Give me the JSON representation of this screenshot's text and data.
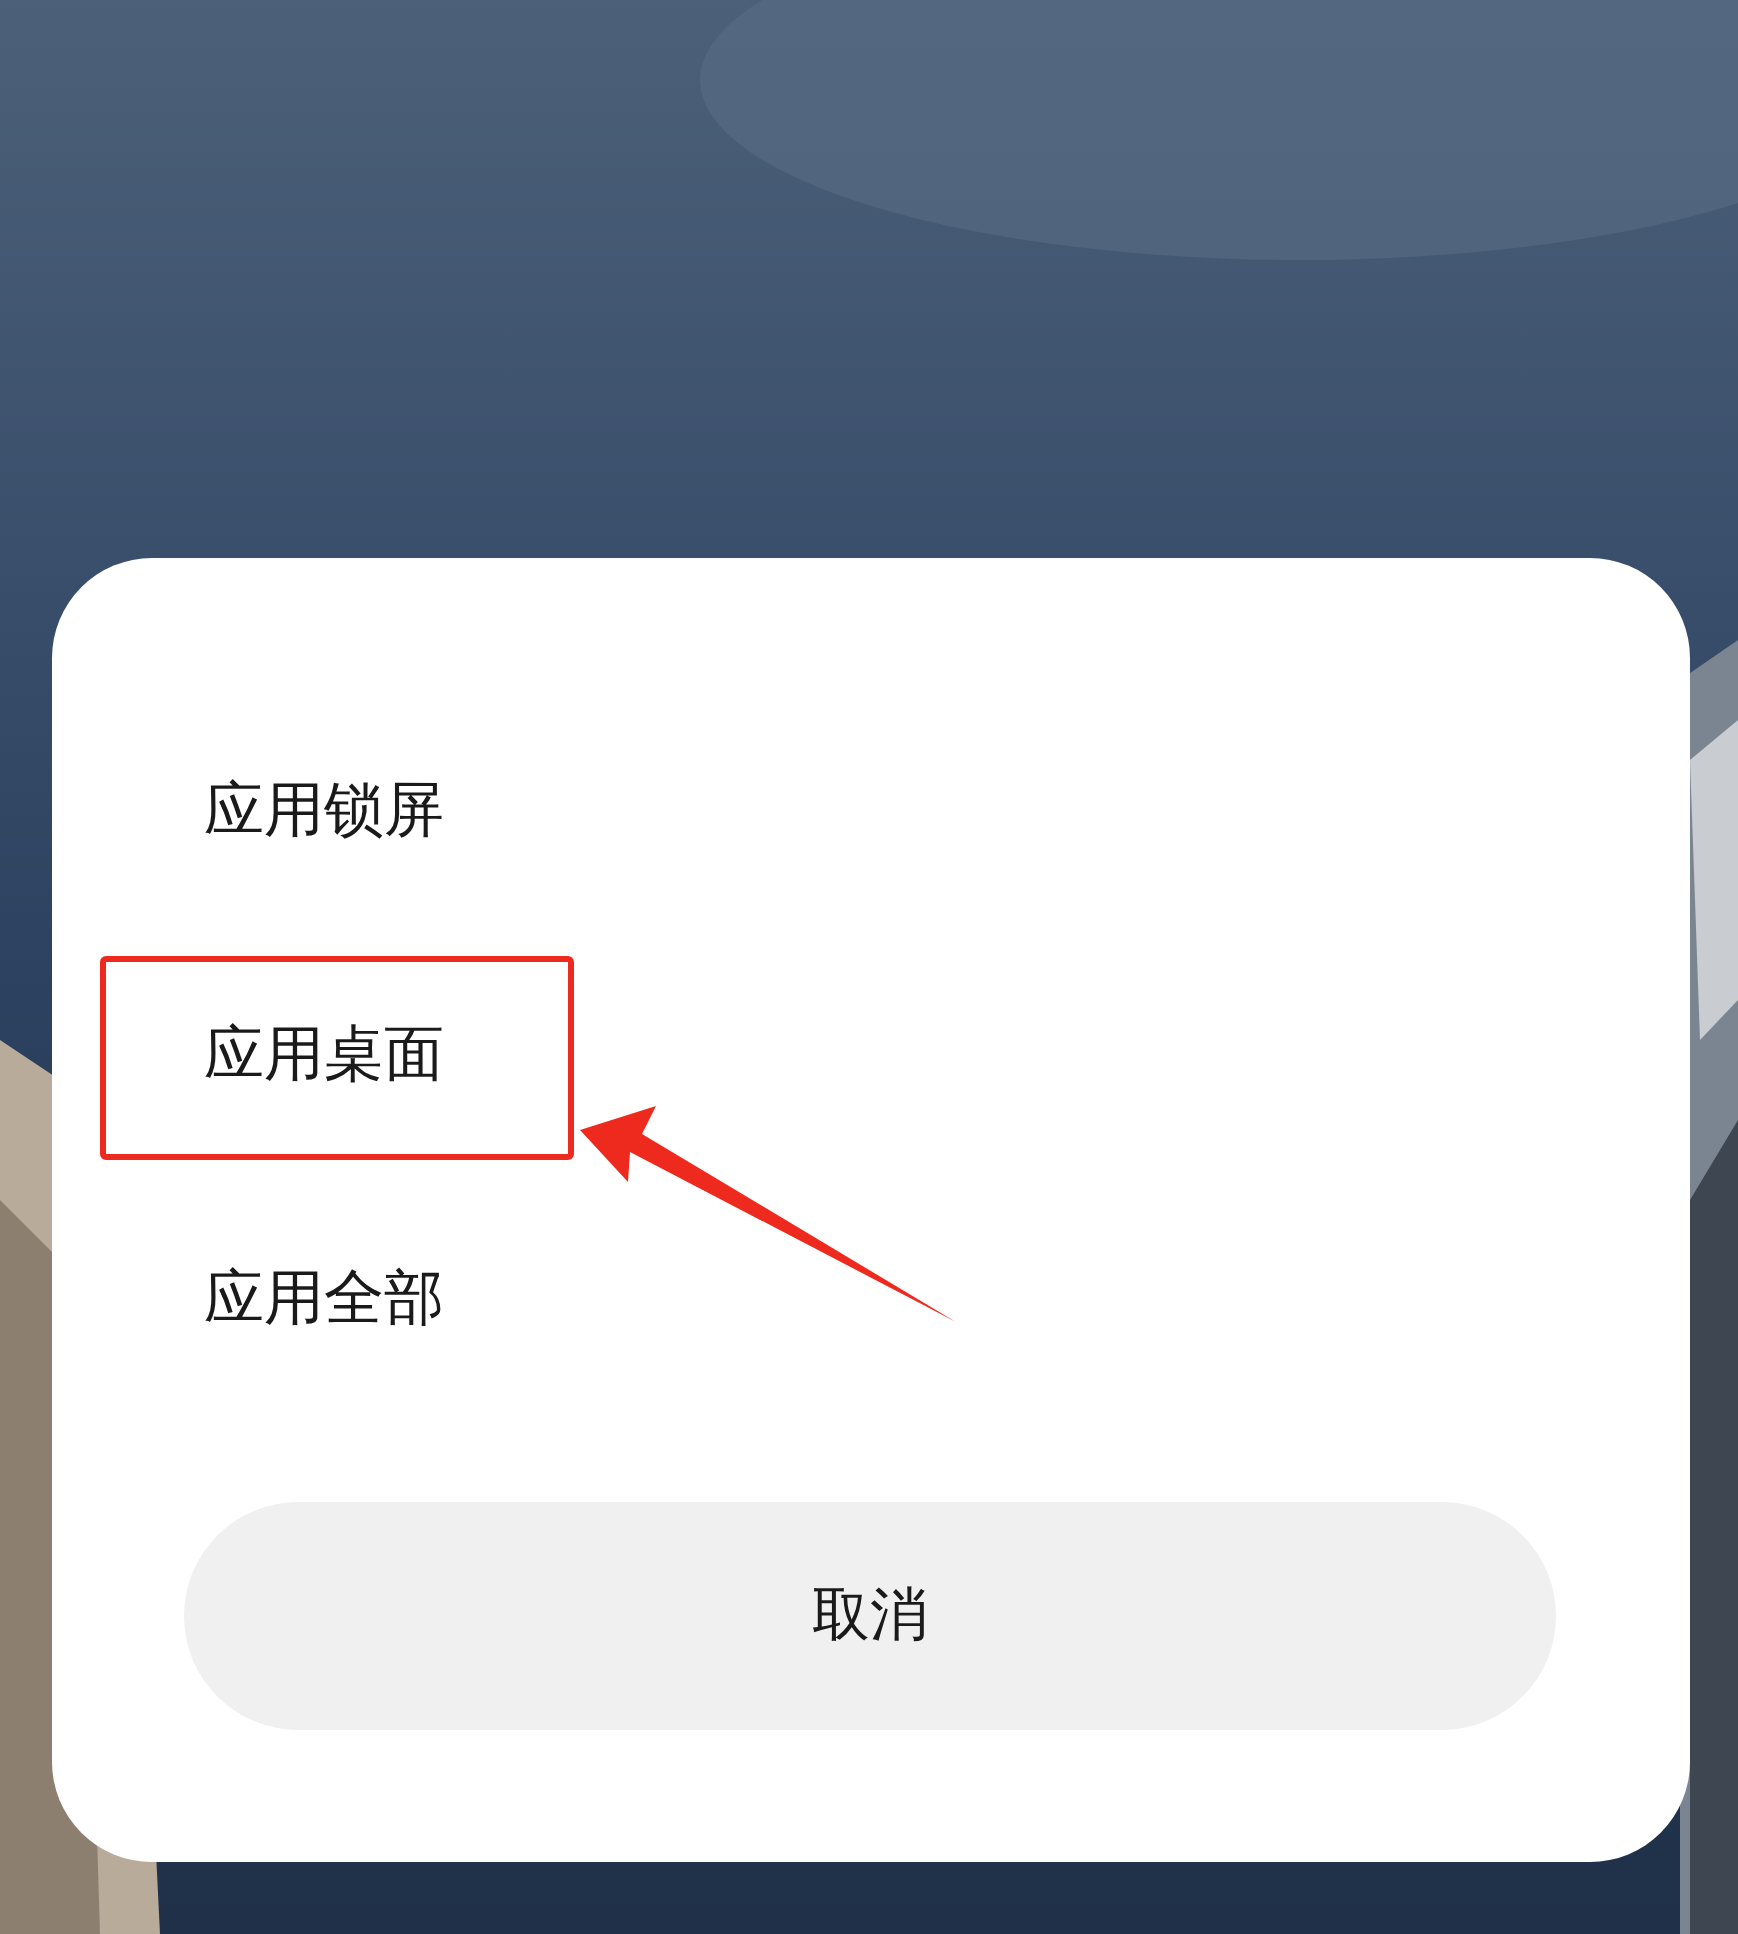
{
  "dialog": {
    "options": [
      {
        "label": "应用锁屏",
        "highlighted": false
      },
      {
        "label": "应用桌面",
        "highlighted": true
      },
      {
        "label": "应用全部",
        "highlighted": false
      }
    ],
    "cancel_button": "取消"
  }
}
